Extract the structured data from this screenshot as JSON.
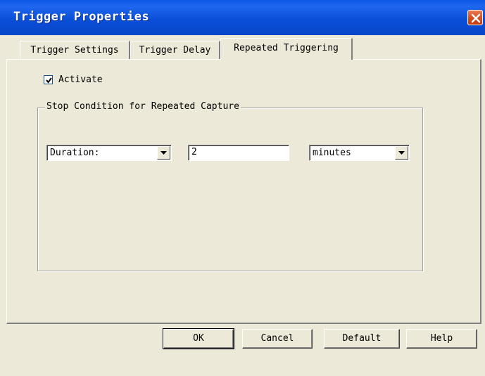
{
  "window": {
    "title": "Trigger Properties"
  },
  "tabs": [
    {
      "label": "Trigger Settings",
      "active": false
    },
    {
      "label": "Trigger Delay",
      "active": false
    },
    {
      "label": "Repeated Triggering",
      "active": true
    }
  ],
  "activate": {
    "label": "Activate",
    "checked": true
  },
  "stop_condition": {
    "legend": "Stop Condition for Repeated Capture",
    "type_select": {
      "value": "Duration:"
    },
    "amount_input": {
      "value": "2"
    },
    "unit_select": {
      "value": "minutes"
    }
  },
  "buttons": {
    "ok": "OK",
    "cancel": "Cancel",
    "default": "Default",
    "help": "Help"
  },
  "colors": {
    "titlebar": "#0a4fd8",
    "dialog_bg": "#ece9d8",
    "close_button": "#d44a1c"
  }
}
